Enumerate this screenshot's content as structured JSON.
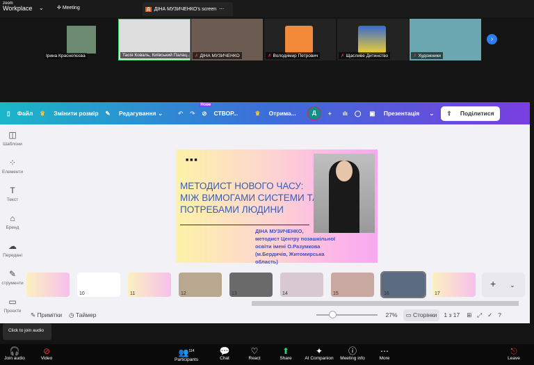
{
  "zoom": {
    "brand_small": "zoom",
    "brand": "Workplace",
    "meeting_label": "Meeting",
    "share_tab": "ДІНА МУЗИЧЕНКО's screen",
    "participants": [
      {
        "name": "Ірина Краснопєєва"
      },
      {
        "name": "Тасія Коваль, Київський Палац..."
      },
      {
        "name": "ДІНА МУЗИЧЕНКО"
      },
      {
        "name": "Володимир Петрович"
      },
      {
        "name": "Щасливе Дитинство"
      },
      {
        "name": "Художники"
      }
    ],
    "tooltip": "Click to join audio",
    "toolbar": {
      "join_audio": "Join audio",
      "video": "Video",
      "participants": "Participants",
      "participants_count": "114",
      "chat": "Chat",
      "react": "React",
      "share": "Share",
      "ai": "AI Companion",
      "info": "Meeting info",
      "more": "More",
      "leave": "Leave"
    }
  },
  "canva": {
    "file": "Файл",
    "resize": "Змінити розмір",
    "edit": "Редагування",
    "new_badge": "Нове",
    "create": "СТВОР...",
    "get": "Отрима...",
    "avatar": "Д",
    "present": "Презентація",
    "share": "Поділитися",
    "sidebar": [
      "Шаблони",
      "Елементи",
      "Текст",
      "Бренд",
      "Передані",
      "струменти",
      "Проєкти"
    ],
    "slide": {
      "dots": "■ ■ ■",
      "title": "МЕТОДИСТ НОВОГО ЧАСУ: МІЖ ВИМОГАМИ СИСТЕМИ ТА ПОТРЕБАМИ ЛЮДИНИ",
      "author": "ДІНА МУЗИЧЕНКО,",
      "desc": "методист Центру позашкільної освіти імені О.Разумкова (м.Бердичів, Житомирська область)"
    },
    "thumbs": [
      "",
      "10",
      "11",
      "12",
      "13",
      "14",
      "15",
      "16",
      "17"
    ],
    "notes": "Примітки",
    "timer": "Таймер",
    "zoom": "27%",
    "pages": "Сторінки",
    "page_info": "1 з 17",
    "add": "+"
  }
}
